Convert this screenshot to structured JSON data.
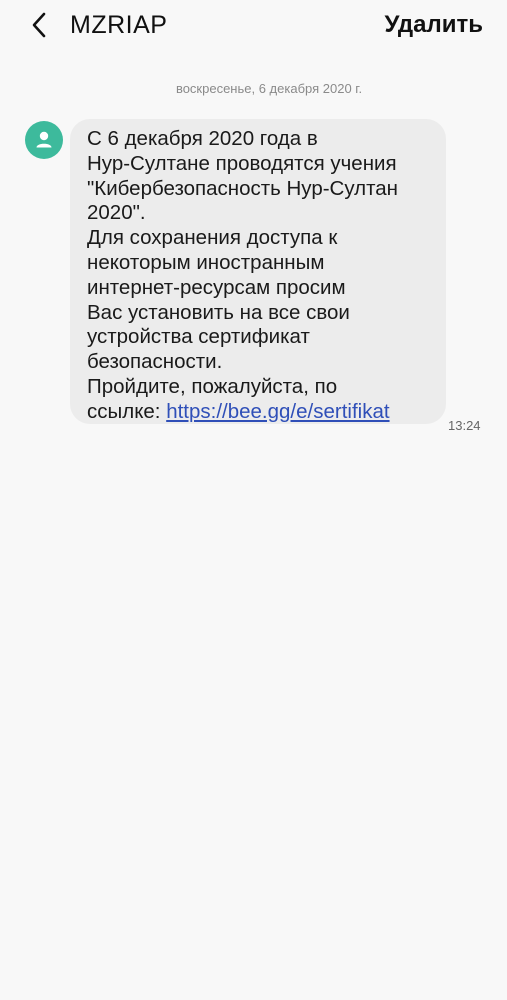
{
  "header": {
    "back_icon": "chevron-left-icon",
    "sender": "MZRIAP",
    "delete_label": "Удалить"
  },
  "conversation": {
    "date": "воскресенье, 6 декабря 2020 г.",
    "message": {
      "avatar_icon": "person-icon",
      "avatar_color": "#3dba9c",
      "lines": [
        "С 6 декабря 2020 года в",
        "Нур-Султане проводятся учения",
        "\"Кибербезопасность Нур-Султан",
        "2020\".",
        "Для сохранения доступа к",
        "некоторым иностранным",
        "интернет-ресурсам просим",
        "Вас установить на все свои",
        "устройства сертификат",
        "безопасности.",
        "Пройдите, пожалуйста, по"
      ],
      "link_prefix": "ссылке: ",
      "link": "https://bee.gg/e/sertifikat",
      "link_color": "#2f4fb8",
      "time": "13:24"
    }
  }
}
